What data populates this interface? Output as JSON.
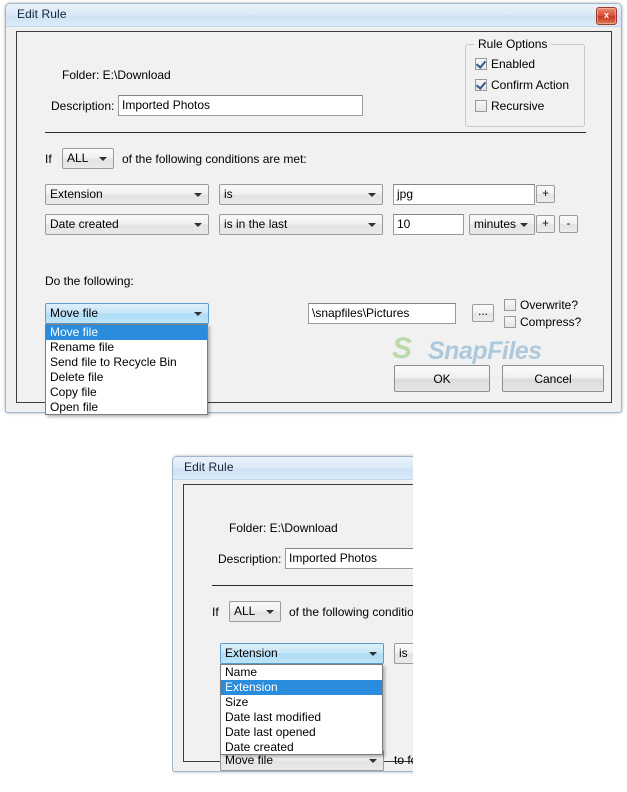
{
  "main_dialog": {
    "title": "Edit Rule",
    "close_button": "x",
    "folder_label": "Folder: E:\\Download",
    "description_label": "Description:",
    "description_value": "Imported Photos",
    "rule_options": {
      "title": "Rule Options",
      "items": [
        {
          "label": "Enabled",
          "checked": true
        },
        {
          "label": "Confirm Action",
          "checked": true
        },
        {
          "label": "Recursive",
          "checked": false
        }
      ]
    },
    "conditions": {
      "if_label": "If",
      "match_mode": "ALL",
      "trailing_label": "of the following conditions are met:",
      "rows": [
        {
          "field": "Extension",
          "operator": "is",
          "value": "jpg",
          "unit": null,
          "add_button": "+",
          "remove_button": null
        },
        {
          "field": "Date created",
          "operator": "is in the last",
          "value": "10",
          "unit": "minutes",
          "add_button": "+",
          "remove_button": "-"
        }
      ]
    },
    "action": {
      "heading": "Do the following:",
      "selected": "Move file",
      "options": [
        "Move file",
        "Rename file",
        "Send file to Recycle Bin",
        "Delete file",
        "Copy file",
        "Open file"
      ],
      "target_path": "\\snapfiles\\Pictures",
      "browse_button": "...",
      "overwrite": {
        "label": "Overwrite?",
        "checked": false
      },
      "compress": {
        "label": "Compress?",
        "checked": false
      }
    },
    "buttons": {
      "ok": "OK",
      "cancel": "Cancel"
    },
    "watermark": {
      "mark": "S",
      "text": "SnapFiles"
    }
  },
  "lower_dialog": {
    "title": "Edit Rule",
    "folder_label": "Folder: E:\\Download",
    "description_label": "Description:",
    "description_value": "Imported Photos",
    "if_label": "If",
    "match_mode": "ALL",
    "trailing_label": "of the following conditions are",
    "field_selected": "Extension",
    "field_options": [
      "Name",
      "Extension",
      "Size",
      "Date last modified",
      "Date last opened",
      "Date created"
    ],
    "operator": "is",
    "action_selected": "Move file",
    "to_folder_label": "to folde"
  },
  "colors": {
    "accent_select": "#2a8cdd",
    "title_gradient_top": "#e9f2fb",
    "title_gradient_bottom": "#cfe1f4",
    "close_red": "#c3391f",
    "watermark_green": "#7fba5a",
    "watermark_blue": "#5d9ac4",
    "dialog_face": "#f1f1f1"
  }
}
